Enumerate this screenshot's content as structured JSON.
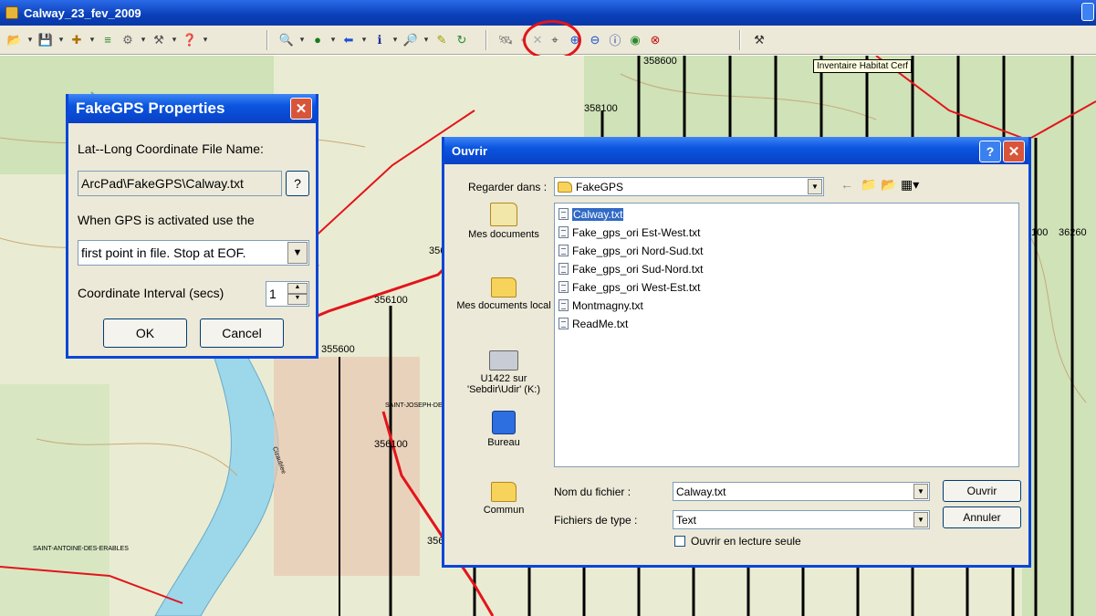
{
  "window": {
    "title": "Calway_23_fev_2009"
  },
  "toolbar": {
    "groups": [
      [
        "file-open",
        "save",
        "add-layer",
        "layer-props",
        "gps-tools",
        "record",
        "help"
      ],
      [
        "zoom",
        "globe",
        "back",
        "identify",
        "find",
        "pen",
        "refresh"
      ],
      [
        "gps",
        "dot",
        "cancel",
        "full-extent",
        "zoom-in",
        "zoom-out",
        "info",
        "center",
        "stop"
      ],
      [
        "survey"
      ]
    ],
    "tooltip": "Inventaire Habitat Cerf"
  },
  "map": {
    "labels": [
      "358600",
      "358100",
      "356",
      "356100",
      "355600",
      "SAINT-JOSEPH-DE",
      "356100",
      "356",
      "100",
      "36260",
      "Cizaublee",
      "SAINT-ANTOINE-DES-ERABLES"
    ],
    "colors": {
      "background": "#e9ecd2",
      "road": "#e3141b",
      "grid": "#000000",
      "water": "#9dd7ea"
    }
  },
  "fakegps": {
    "title": "FakeGPS Properties",
    "file_label": "Lat--Long Coordinate File Name:",
    "file_value": "ArcPad\\FakeGPS\\Calway.txt",
    "browse_label": "?",
    "activate_label": "When GPS is activated use the",
    "mode_value": "first point in file. Stop at EOF.",
    "interval_label": "Coordinate Interval (secs)",
    "interval_value": "1",
    "ok_label": "OK",
    "cancel_label": "Cancel"
  },
  "ouvrir": {
    "title": "Ouvrir",
    "look_in_label": "Regarder dans :",
    "look_in_value": "FakeGPS",
    "places": [
      {
        "label": "Mes documents",
        "icon": "my-documents-icon"
      },
      {
        "label": "Mes documents local",
        "icon": "folder-icon"
      },
      {
        "label": "U1422 sur 'Sebdir\\Udir' (K:)",
        "icon": "network-drive-icon"
      },
      {
        "label": "Bureau",
        "icon": "desktop-icon"
      },
      {
        "label": "Commun",
        "icon": "folder-icon"
      }
    ],
    "files": [
      "Calway.txt",
      "Fake_gps_ori Est-West.txt",
      "Fake_gps_ori Nord-Sud.txt",
      "Fake_gps_ori Sud-Nord.txt",
      "Fake_gps_ori West-Est.txt",
      "Montmagny.txt",
      "ReadMe.txt"
    ],
    "selected_file": "Calway.txt",
    "filename_label": "Nom du fichier :",
    "filename_value": "Calway.txt",
    "filetype_label": "Fichiers de type :",
    "filetype_value": "Text",
    "readonly_label": "Ouvrir en lecture seule",
    "readonly_checked": false,
    "open_label": "Ouvrir",
    "cancel_label": "Annuler"
  }
}
